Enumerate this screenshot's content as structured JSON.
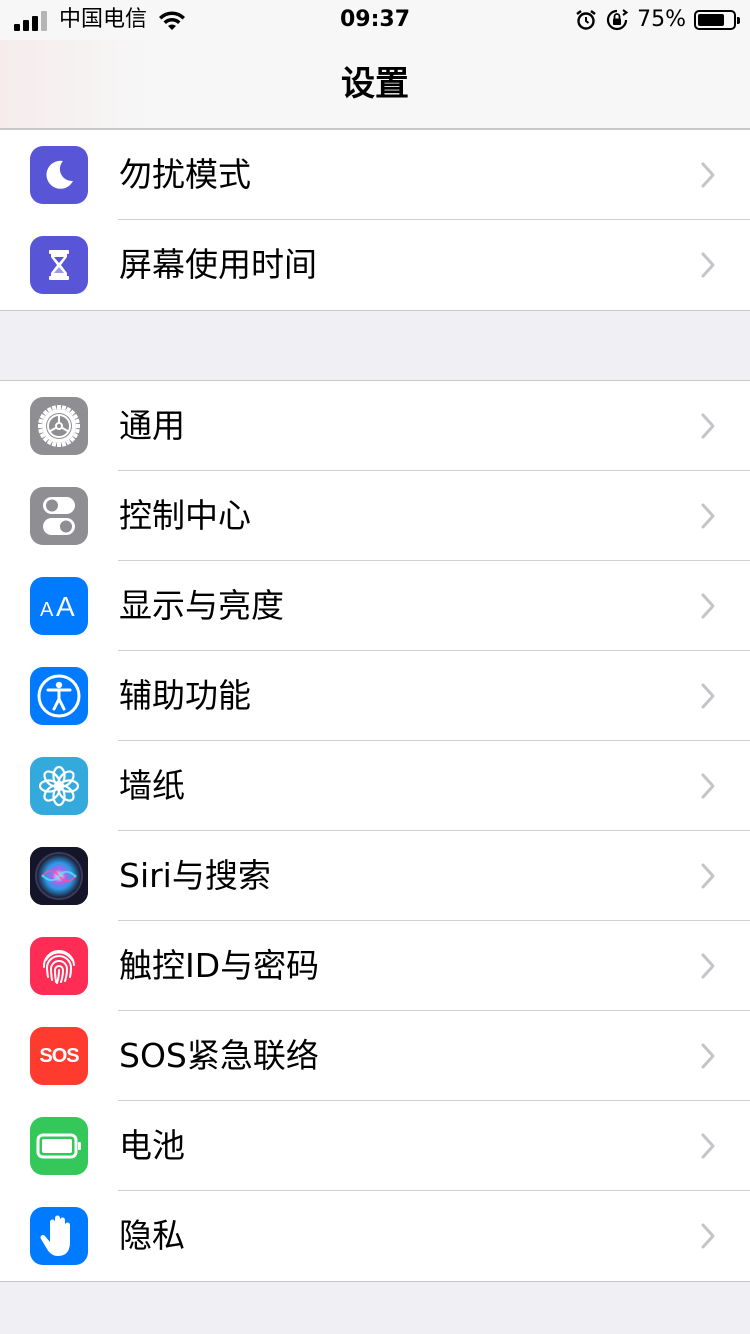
{
  "status_bar": {
    "carrier": "中国电信",
    "time": "09:37",
    "battery_percent": "75%",
    "battery_level": 0.75
  },
  "nav": {
    "title": "设置"
  },
  "groups": [
    {
      "items": [
        {
          "label": "勿扰模式",
          "icon": "moon-icon",
          "color": "#5856d6"
        },
        {
          "label": "屏幕使用时间",
          "icon": "hourglass-icon",
          "color": "#5856d6"
        }
      ]
    },
    {
      "items": [
        {
          "label": "通用",
          "icon": "gear-icon",
          "color": "#8e8e93"
        },
        {
          "label": "控制中心",
          "icon": "toggles-icon",
          "color": "#8e8e93"
        },
        {
          "label": "显示与亮度",
          "icon": "text-size-icon",
          "color": "#007aff"
        },
        {
          "label": "辅助功能",
          "icon": "accessibility-icon",
          "color": "#007aff"
        },
        {
          "label": "墙纸",
          "icon": "flower-icon",
          "color": "#34aadc"
        },
        {
          "label": "Siri与搜索",
          "icon": "siri-icon",
          "color": "#1c1c2e"
        },
        {
          "label": "触控ID与密码",
          "icon": "fingerprint-icon",
          "color": "#ff2d55"
        },
        {
          "label": "SOS紧急联络",
          "icon": "sos-icon",
          "color": "#ff3b30",
          "icon_text": "SOS"
        },
        {
          "label": "电池",
          "icon": "battery-icon",
          "color": "#34c759"
        },
        {
          "label": "隐私",
          "icon": "hand-icon",
          "color": "#007aff"
        }
      ]
    }
  ]
}
